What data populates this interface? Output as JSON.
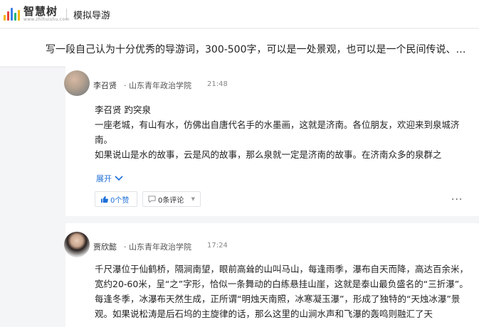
{
  "header": {
    "logo_name": "智慧树",
    "logo_url": "www.zhihuishu.com",
    "section_title": "模拟导游",
    "colors": {
      "logo_bars": [
        "#f5b400",
        "#e8453c",
        "#3b7fe6",
        "#2bb673",
        "#f5b400",
        "#3b7fe6"
      ]
    }
  },
  "question": {
    "text": "写一段自己认为十分优秀的导游词，300-500字，可以是一处景观，也可以是一个民间传说、…"
  },
  "answers": [
    {
      "author": "李召贤",
      "school": "· 山东青年政治学院",
      "time": "21:48",
      "paragraphs": [
        "李召贤 趵突泉",
        "一座老城，有山有水，仿佛出自唐代名手的水墨画，这就是济南。各位朋友，欢迎来到泉城济南。",
        "如果说山是水的故事，云是风的故事，那么泉就一定是济南的故事。在济南众多的泉群之"
      ],
      "expand_label": "展开",
      "like_label": "0个赞",
      "comment_label": "0条评论",
      "more_label": "···"
    },
    {
      "author": "贾欣懿",
      "school": "· 山东青年政治学院",
      "time": "17:24",
      "paragraphs": [
        "千尺瀑位于仙鹤桥，隔涧南望，眼前高耸的山叫马山，每逢雨季，瀑布自天而降，高达百余米，宽约20-60米，呈“之”字形，恰似一条舞动的白练悬挂山崖，这就是泰山最负盛名的“三折瀑”。每逢冬季，冰瀑布天然生成，正所谓“明烛天南照，冰寒凝玉瀑”，形成了独特的“天烛冰瀑”景观。如果说松涛是后石坞的主旋律的话，那么这里的山涧水声和飞瀑的轰鸣则融汇了天"
      ]
    }
  ],
  "colors": {
    "link": "#1e6fd9",
    "background": "#f4f5f7"
  },
  "icons": {
    "like": "thumbs-up-icon",
    "comment": "comment-icon",
    "expand": "chevron-down-icon",
    "more": "more-dots"
  }
}
